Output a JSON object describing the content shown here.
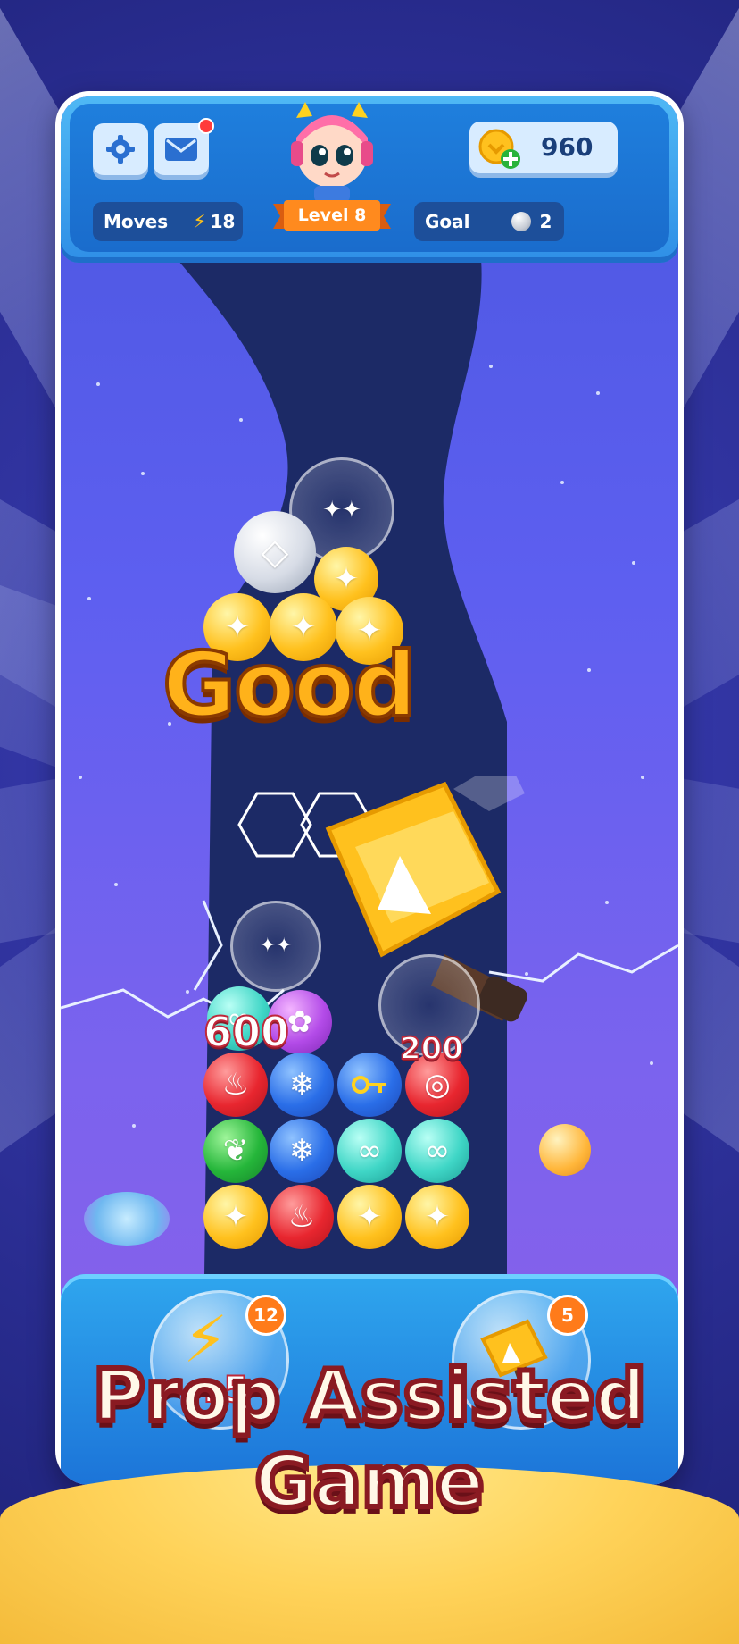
{
  "header": {
    "moves_label": "Moves",
    "moves_value": "18",
    "level_label": "Level 8",
    "coins_value": "960",
    "goal_label": "Goal",
    "goal_value": "2"
  },
  "board": {
    "combo_text": "Good",
    "score_popups": [
      "600",
      "200"
    ]
  },
  "props": {
    "lightning_bonus": "+5",
    "lightning_count": "12",
    "hammer_count": "5"
  },
  "promo": {
    "line1": "Prop Assisted",
    "line2": "Game"
  },
  "icons": {
    "settings": "gear-icon",
    "mail": "mail-icon",
    "lightning": "lightning-icon",
    "diamond": "diamond-icon",
    "coin": "coin-icon"
  },
  "colors": {
    "header_blue": "#2f8fe6",
    "bubble_yellow": "#ffc11e",
    "bubble_red": "#e8262f",
    "bubble_blue": "#2a6ee8",
    "bubble_green": "#25b63a",
    "bubble_teal": "#3fd6c6",
    "combo_text": "#ffb21a",
    "promo_text": "#fff8e8"
  }
}
